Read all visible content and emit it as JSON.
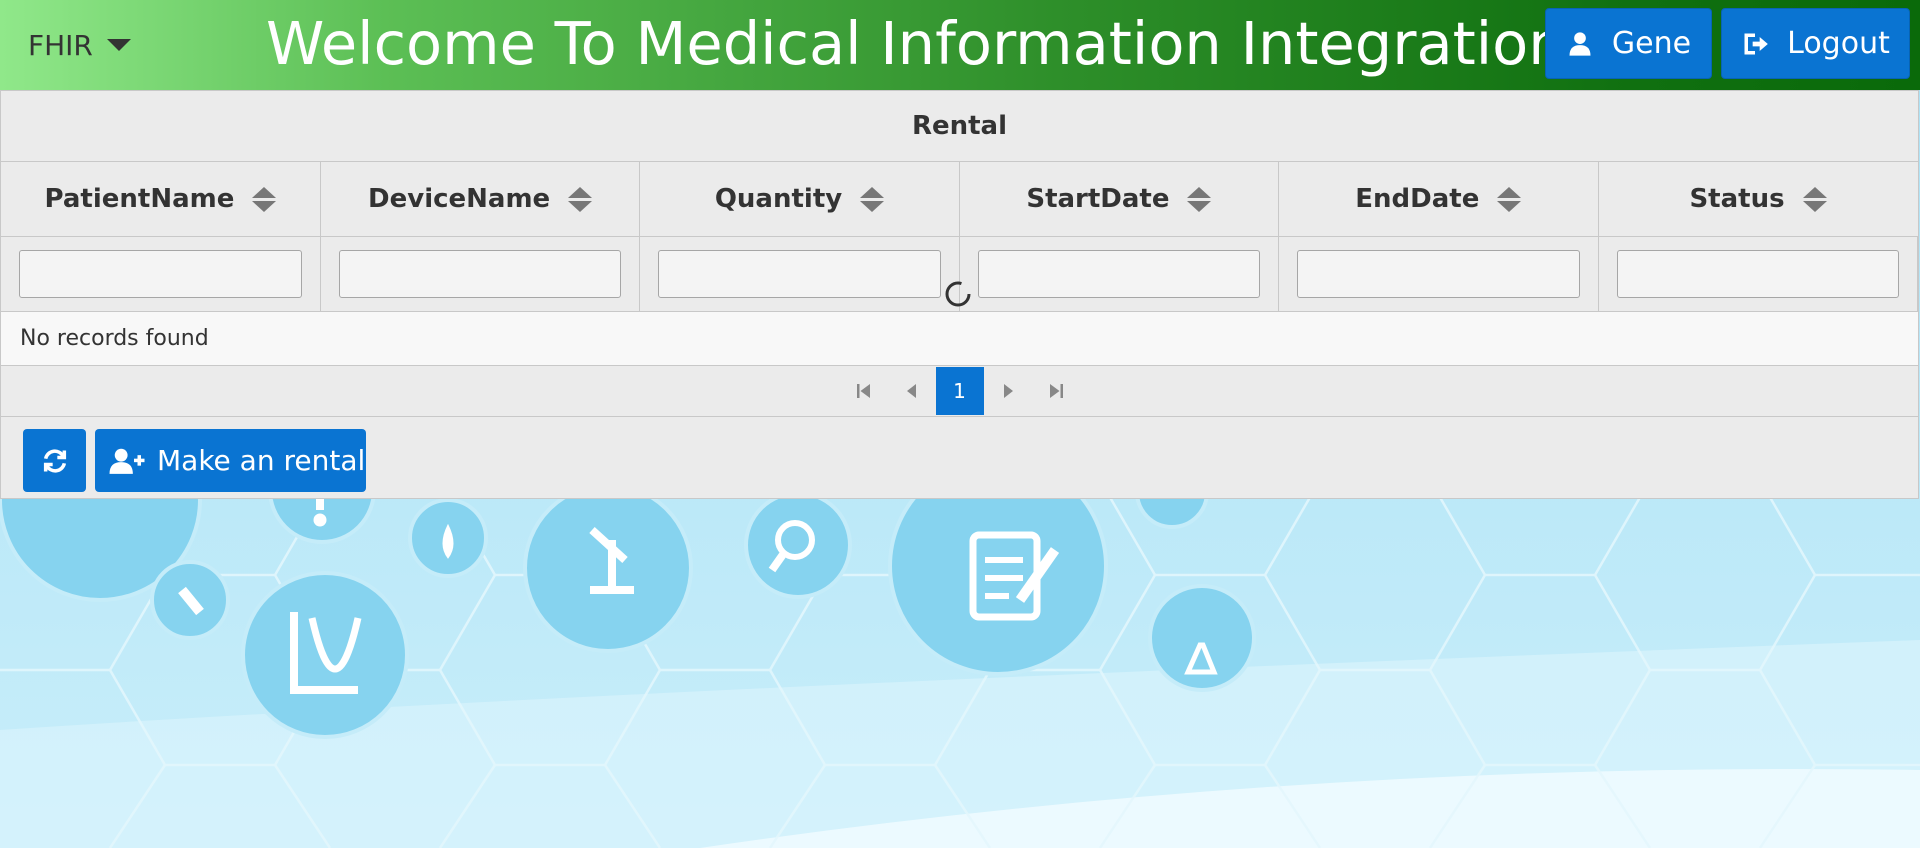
{
  "header": {
    "menu_label": "FHIR",
    "welcome_text": "Welcome To Medical Information Integration System",
    "user_button_label": "Gene",
    "logout_button_label": "Logout"
  },
  "panel": {
    "title": "Rental",
    "columns": [
      "PatientName",
      "DeviceName",
      "Quantity",
      "StartDate",
      "EndDate",
      "Status"
    ],
    "empty_message": "No records found",
    "current_page": "1",
    "add_button_label": "Make an rental"
  },
  "colors": {
    "accent": "#0a74d2",
    "header_gradient_start": "#90e88a",
    "header_gradient_end": "#0a6a0a"
  }
}
